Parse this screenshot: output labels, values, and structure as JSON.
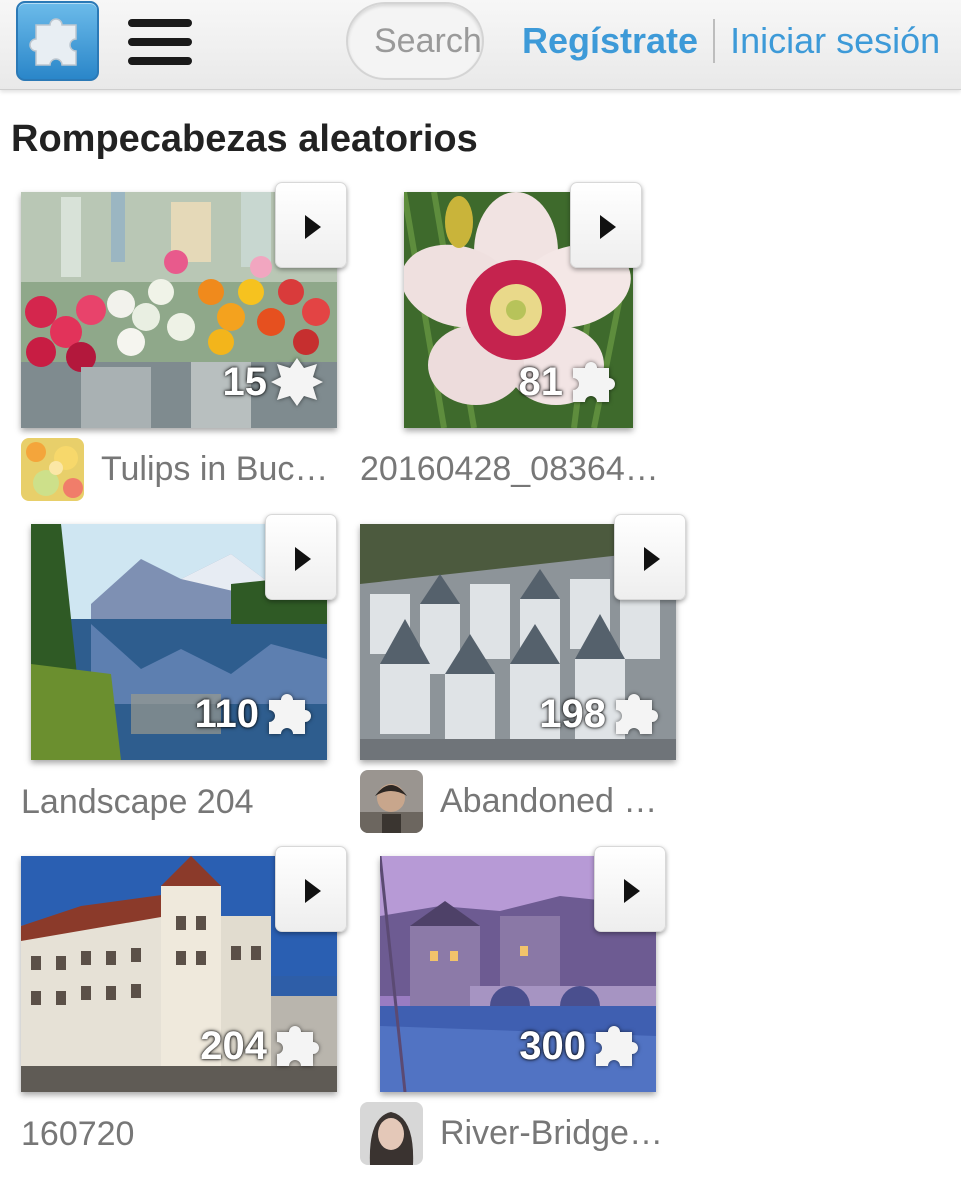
{
  "header": {
    "logo_icon": "puzzle-piece-icon",
    "menu_icon": "hamburger-menu-icon",
    "search_placeholder": "Search",
    "register_label": "Regístrate",
    "login_label": "Iniciar sesión",
    "accent_color": "#3d9ad8"
  },
  "section": {
    "title": "Rompecabezas aleatorios"
  },
  "puzzles": [
    {
      "count": "15",
      "title": "Tulips in Buc…",
      "has_avatar": true
    },
    {
      "count": "81",
      "title": "20160428_08364…",
      "has_avatar": false
    },
    {
      "count": "110",
      "title": "Landscape 204",
      "has_avatar": false
    },
    {
      "count": "198",
      "title": "Abandoned …",
      "has_avatar": true
    },
    {
      "count": "204",
      "title": "160720",
      "has_avatar": false
    },
    {
      "count": "300",
      "title": "River-Bridge…",
      "has_avatar": true
    }
  ]
}
